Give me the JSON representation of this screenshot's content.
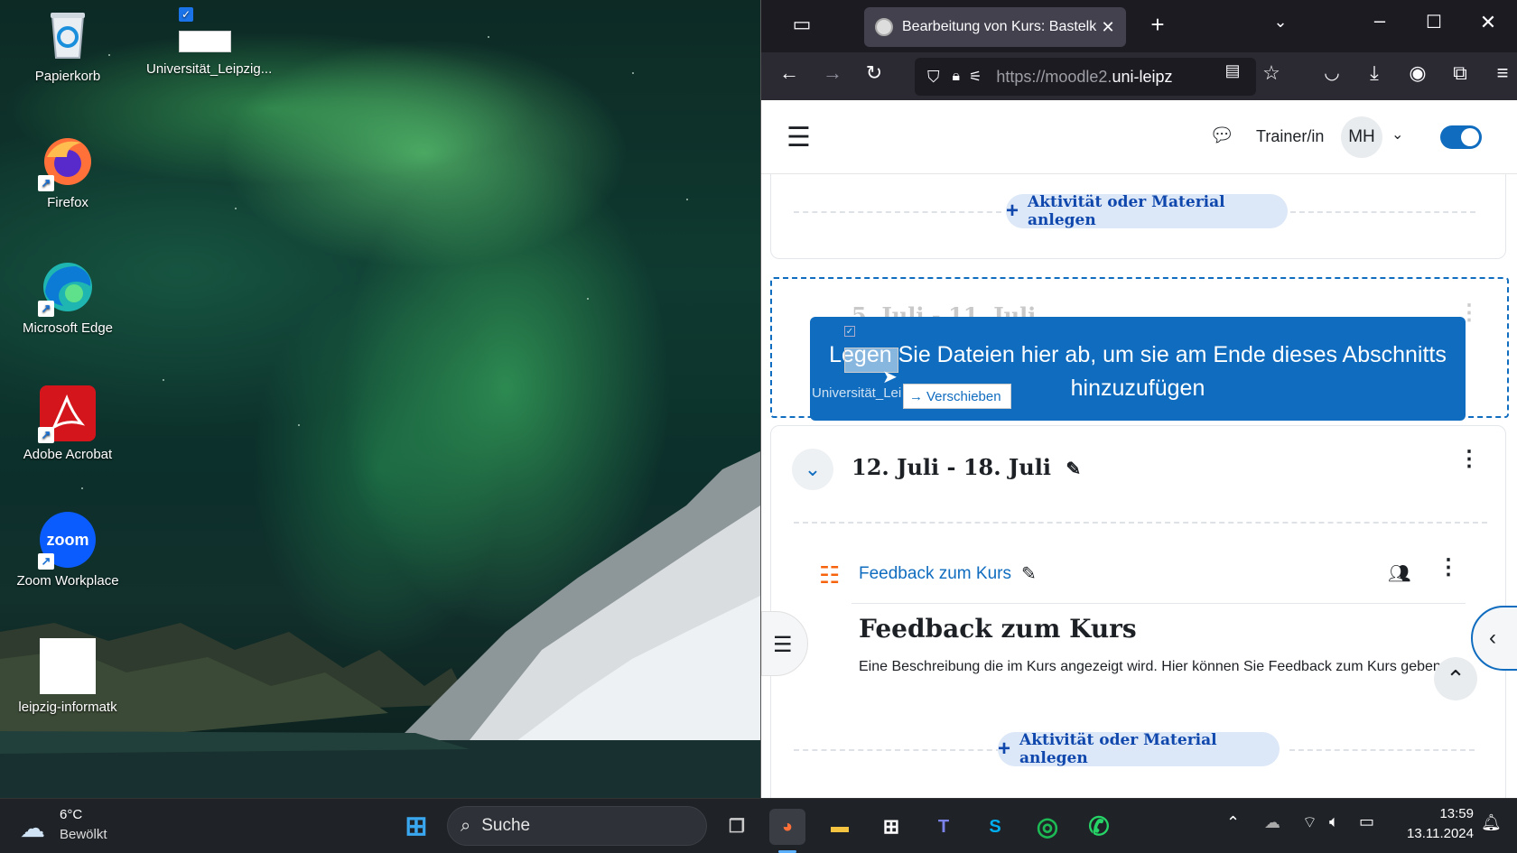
{
  "desktop": {
    "icons": [
      {
        "label": "Papierkorb"
      },
      {
        "label": "Universität_Leipzig..."
      },
      {
        "label": "Firefox"
      },
      {
        "label": "Microsoft Edge"
      },
      {
        "label": "Adobe Acrobat"
      },
      {
        "label": "Zoom Workplace"
      },
      {
        "label": "leipzig-informatk"
      }
    ],
    "zoom_logo": "zoom"
  },
  "browser": {
    "tab_title": "Bearbeitung von Kurs: Bastelkurs",
    "url_prefix": "https://moodle2.",
    "url_host": "uni-leipz",
    "moodle": {
      "role": "Trainer/in",
      "user_initials": "MH",
      "add_activity_label": "Aktivität oder Material anlegen",
      "faded_section_title": "5. Juli - 11. Juli",
      "drop_message": "Legen Sie Dateien hier ab, um sie am Ende dieses Abschnitts hinzuzufügen",
      "drag_file_label": "Universität_Lei",
      "move_tooltip": "Verschieben",
      "section_title": "12. Juli - 18. Juli",
      "activity_link": "Feedback zum Kurs",
      "activity_title": "Feedback zum Kurs",
      "activity_description": "Eine Beschreibung die im Kurs angezeigt wird. Hier können Sie Feedback zum Kurs geben."
    }
  },
  "taskbar": {
    "weather_temp": "6°C",
    "weather_desc": "Bewölkt",
    "search_placeholder": "Suche",
    "time": "13:59",
    "date": "13.11.2024"
  },
  "colors": {
    "moodle_blue": "#0f6cbf",
    "firefox_dark": "#1c1b22"
  }
}
